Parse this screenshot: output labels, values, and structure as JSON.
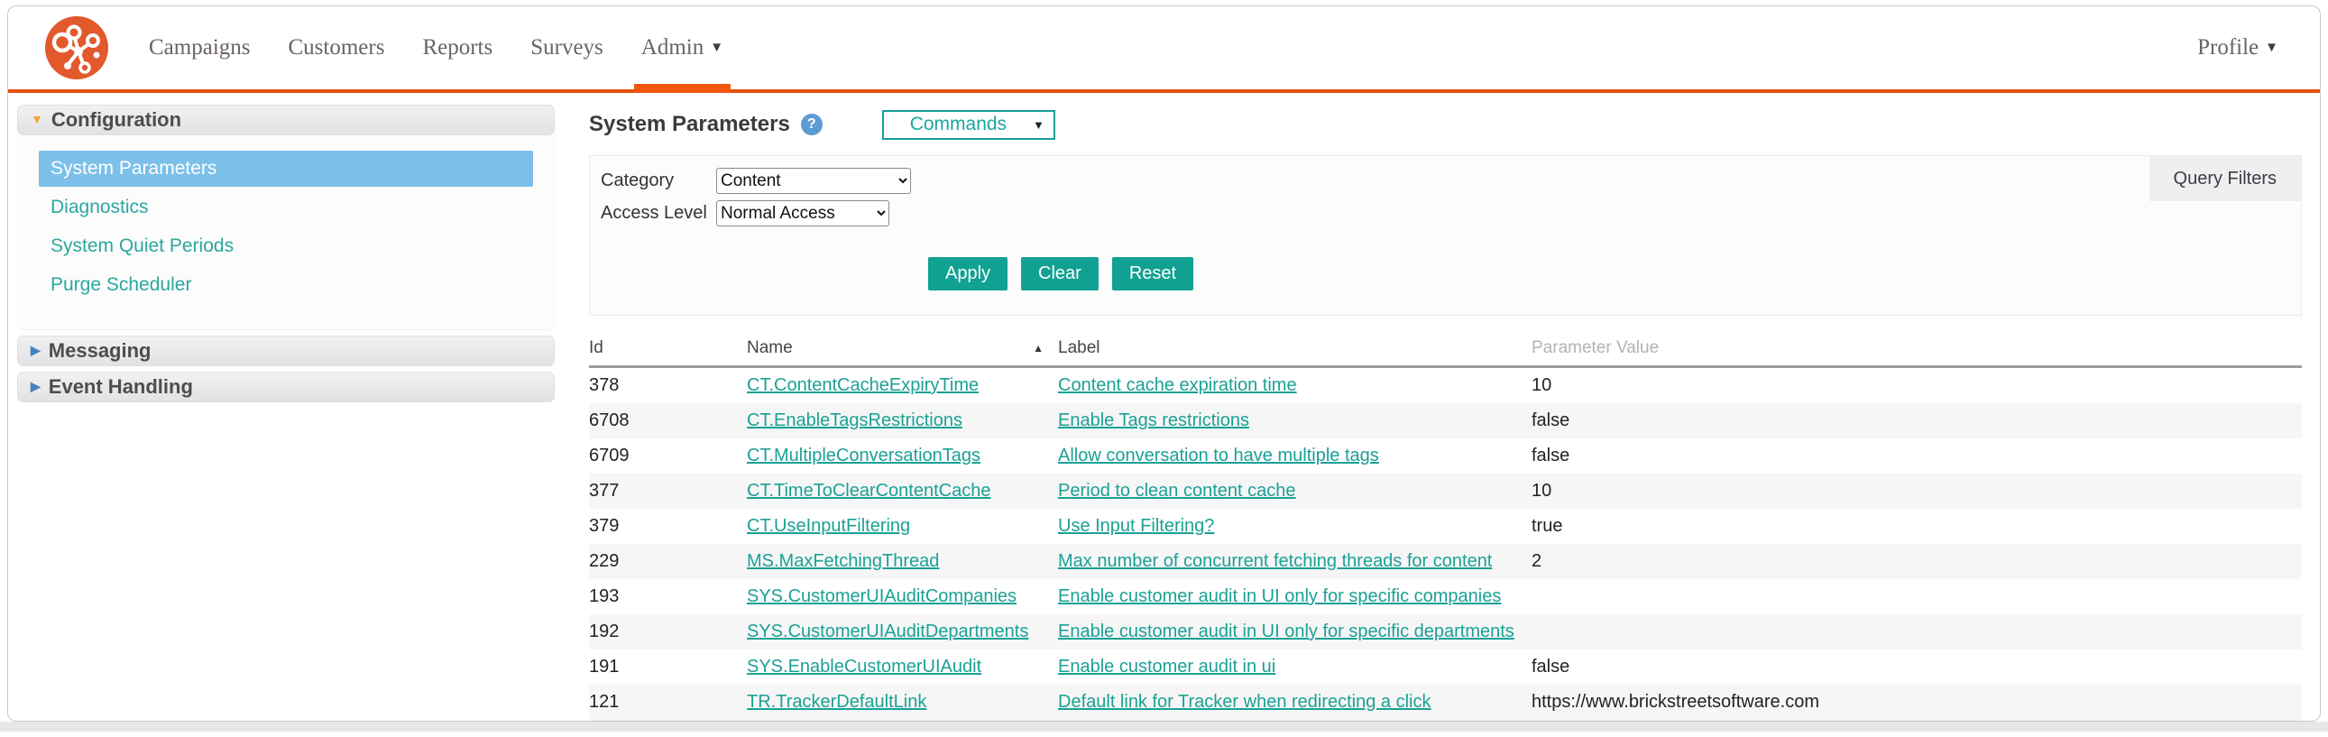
{
  "colors": {
    "accent_orange": "#e8520c",
    "brand_logo_orange": "#e2592c",
    "teal_accent": "#12a193",
    "link_teal": "#1aa195",
    "selected_item_blue": "#7cc0ea",
    "help_icon_blue": "#5d9bd3"
  },
  "topnav": {
    "items": [
      {
        "label": "Campaigns",
        "active": false,
        "dropdown": false
      },
      {
        "label": "Customers",
        "active": false,
        "dropdown": false
      },
      {
        "label": "Reports",
        "active": false,
        "dropdown": false
      },
      {
        "label": "Surveys",
        "active": false,
        "dropdown": false
      },
      {
        "label": "Admin",
        "active": true,
        "dropdown": true
      }
    ],
    "profile": {
      "label": "Profile",
      "dropdown": true
    }
  },
  "sidebar": {
    "sections": [
      {
        "label": "Configuration",
        "expanded": true,
        "items": [
          {
            "label": "System Parameters",
            "selected": true
          },
          {
            "label": "Diagnostics",
            "selected": false
          },
          {
            "label": "System Quiet Periods",
            "selected": false
          },
          {
            "label": "Purge Scheduler",
            "selected": false
          }
        ]
      },
      {
        "label": "Messaging",
        "expanded": false,
        "items": []
      },
      {
        "label": "Event Handling",
        "expanded": false,
        "items": []
      }
    ]
  },
  "main": {
    "title": "System Parameters",
    "help_icon": "question-mark",
    "commands_label": "Commands",
    "filters": {
      "panel_label": "Query Filters",
      "fields": [
        {
          "label": "Category",
          "value": "Content"
        },
        {
          "label": "Access Level",
          "value": "Normal Access"
        }
      ],
      "buttons": [
        {
          "label": "Apply"
        },
        {
          "label": "Clear"
        },
        {
          "label": "Reset"
        }
      ]
    },
    "table": {
      "columns": [
        {
          "label": "Id",
          "muted": false,
          "sorted": null
        },
        {
          "label": "Name",
          "muted": false,
          "sorted": "asc"
        },
        {
          "label": "Label",
          "muted": false,
          "sorted": null
        },
        {
          "label": "Parameter Value",
          "muted": true,
          "sorted": null
        }
      ],
      "rows": [
        {
          "id": "378",
          "name": "CT.ContentCacheExpiryTime",
          "label": "Content cache expiration time",
          "value": "10"
        },
        {
          "id": "6708",
          "name": "CT.EnableTagsRestrictions",
          "label": "Enable Tags restrictions",
          "value": "false"
        },
        {
          "id": "6709",
          "name": "CT.MultipleConversationTags",
          "label": "Allow conversation to have multiple tags",
          "value": "false"
        },
        {
          "id": "377",
          "name": "CT.TimeToClearContentCache",
          "label": "Period to clean content cache",
          "value": "10"
        },
        {
          "id": "379",
          "name": "CT.UseInputFiltering",
          "label": "Use Input Filtering?",
          "value": "true"
        },
        {
          "id": "229",
          "name": "MS.MaxFetchingThread",
          "label": "Max number of concurrent fetching threads for content",
          "value": "2"
        },
        {
          "id": "193",
          "name": "SYS.CustomerUIAuditCompanies",
          "label": "Enable customer audit in UI only for specific companies",
          "value": ""
        },
        {
          "id": "192",
          "name": "SYS.CustomerUIAuditDepartments",
          "label": "Enable customer audit in UI only for specific departments",
          "value": ""
        },
        {
          "id": "191",
          "name": "SYS.EnableCustomerUIAudit",
          "label": "Enable customer audit in ui",
          "value": "false"
        },
        {
          "id": "121",
          "name": "TR.TrackerDefaultLink",
          "label": "Default link for Tracker when redirecting a click",
          "value": "https://www.brickstreetsoftware.com"
        }
      ]
    }
  }
}
